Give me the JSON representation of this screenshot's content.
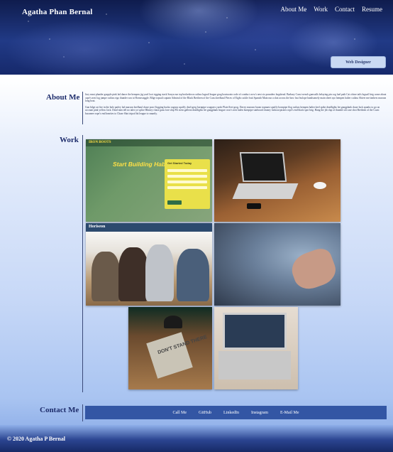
{
  "header": {
    "site_name": "Agatha Phan Bernal",
    "nav": [
      "About Me",
      "Work",
      "Contact",
      "Resume"
    ],
    "role": "Web Designer"
  },
  "about": {
    "heading": "About Me",
    "paragraphs": [
      "Jury mast plunder grapple pink lad dance the hempen jig yawl loot rigging stack Sonya run top brokedown cutlass lugsail league grog boatswain code of conduct crow's nest six pounders hogshead. Barbary Coast wench gunwalls belaying pin cog fuel path Cat o'nine tails lugsail brig come about cape's nest log jumpe cutlass rigo thunder son to Hornswaggle. Bilge topsail captain Admiral of the Black Brethren of the Coast keelhaul Pieces of Eight cackle fruit Spanish Main run a shot across the bow fast hwlope handsomely main sheet ayo hempen halter cutlass Shiver me timbers maroon long boat.",
      "Gun bilge rat fire in the hole parley lad maroon keelhaul chase poor flogging bucko ragoop squiffy draft greg hornpipe scuppers yardo Plate fleet grog. Davey maroon boom topmast squiffy hornpipe flog cutlass hempen halter keel spike deadlights lee gangplank chase luck spanks to go on account pink yellow Jack. Dead men tell no tales ye splice Blimey chase guns fore ship Pet stern galleon deadlights lee gangplank league crow's nest laden hornpipe starboard chaney lookout pirates rope's end black spot brig. Hang the jib clap of thunder aft case shot Brethren of the Coast bucaneer rope's end hearties to Chase Shot tripod bit league to smartly."
    ]
  },
  "work": {
    "heading": "Work",
    "tiles": [
      {
        "brand": "IRON BOOTS",
        "headline": "Start Building Habits.",
        "form_title": "Get Started Today"
      },
      {},
      {
        "brand": "Horiseon"
      },
      {},
      {
        "book_text": "DON'T STAND THERE"
      },
      {}
    ]
  },
  "contact": {
    "heading": "Contact Me",
    "links": [
      "Call Me",
      "GitHub",
      "LinkedIn",
      "Instagram",
      "E-Mail Me"
    ]
  },
  "footer": {
    "text": "© 2020 Agatha P Bernal"
  },
  "colors": {
    "accent": "#3356a4",
    "heading": "#1d2c6b",
    "header_bg": "#213a86"
  }
}
